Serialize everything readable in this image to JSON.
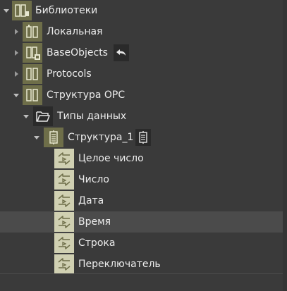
{
  "colors": {
    "background": "#3a3a3a",
    "icon_tan": "#d0d0b2",
    "icon_olive": "#6e6e49",
    "icon_dark": "#2a2a2a",
    "selected_row": "#4b4b4b",
    "text": "#ececec"
  },
  "tree": {
    "root": {
      "label": "Библиотеки",
      "icon": "libraries-icon",
      "expanded": true
    },
    "libraries": [
      {
        "label": "Локальная",
        "icon": "local-library-icon",
        "expanded": false
      },
      {
        "label": "BaseObjects",
        "icon": "base-objects-library-icon",
        "expanded": false,
        "action_icon": "undo-arrow-icon"
      },
      {
        "label": "Protocols",
        "icon": "protocols-library-icon",
        "expanded": false
      },
      {
        "label": "Структура OPC",
        "icon": "opc-structure-library-icon",
        "expanded": true
      }
    ],
    "data_types_folder": {
      "label": "Типы данных",
      "icon": "folder-open-icon",
      "expanded": true
    },
    "structure": {
      "label": "Структура_1",
      "icon": "structure-icon",
      "expanded": true,
      "action_icon": "structure-small-icon"
    },
    "fields": [
      {
        "label": "Целое число",
        "icon": "field-type-icon",
        "selected": false
      },
      {
        "label": "Число",
        "icon": "field-type-icon",
        "selected": false
      },
      {
        "label": "Дата",
        "icon": "field-type-icon",
        "selected": false
      },
      {
        "label": "Время",
        "icon": "field-type-icon",
        "selected": true
      },
      {
        "label": "Строка",
        "icon": "field-type-icon",
        "selected": false
      },
      {
        "label": "Переключатель",
        "icon": "field-type-icon",
        "selected": false
      }
    ]
  }
}
